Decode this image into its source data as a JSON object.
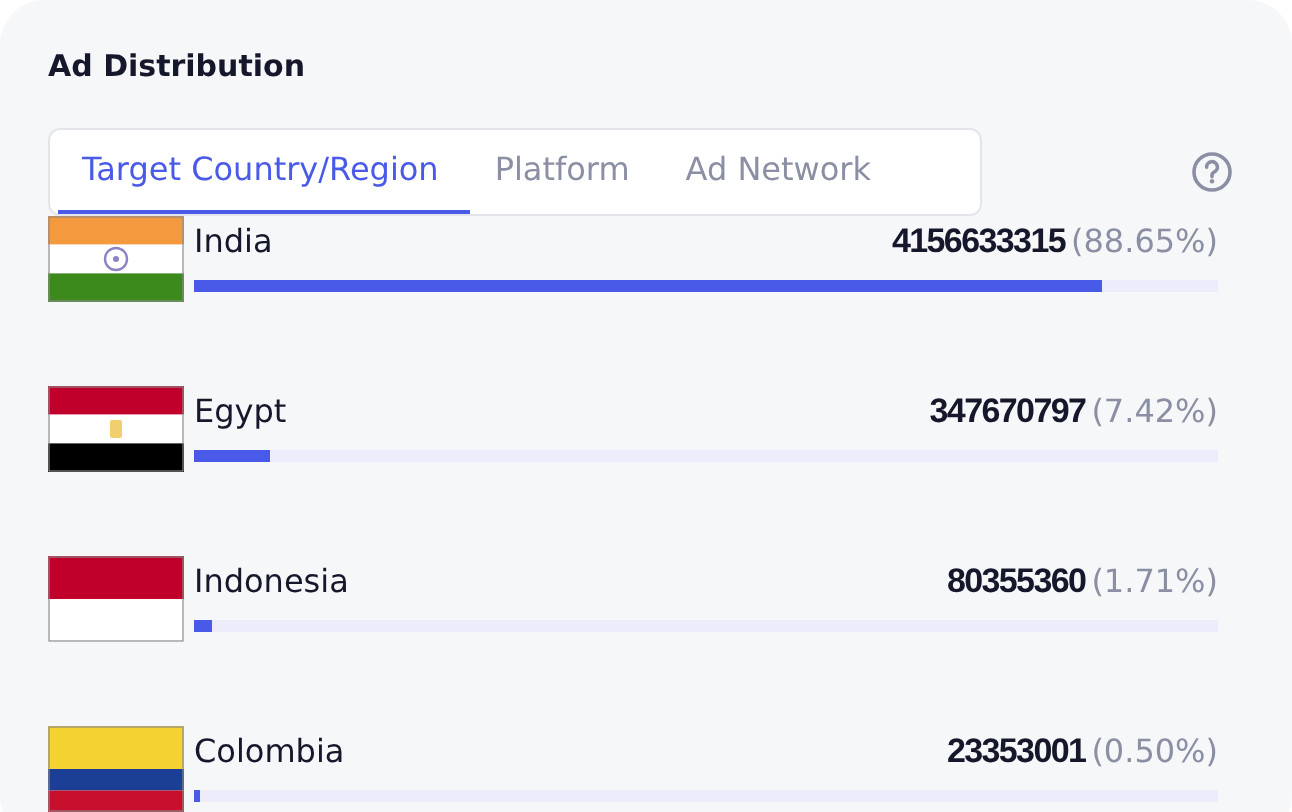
{
  "title": "Ad Distribution",
  "tabs": [
    {
      "label": "Target Country/Region",
      "selected": true
    },
    {
      "label": "Platform",
      "selected": false
    },
    {
      "label": "Ad Network",
      "selected": false
    }
  ],
  "rows": [
    {
      "kind": "india",
      "name": "India",
      "count": "4156633315",
      "share": "(88.65%)",
      "level": 0.8865
    },
    {
      "kind": "egypt",
      "name": "Egypt",
      "count": "347670797",
      "share": "(7.42%)",
      "level": 0.0742
    },
    {
      "kind": "indonesia",
      "name": "Indonesia",
      "count": "80355360",
      "share": "(1.71%)",
      "level": 0.0171
    },
    {
      "kind": "colombia",
      "name": "Colombia",
      "count": "23353001",
      "share": "(0.50%)",
      "level": 0.005
    }
  ]
}
